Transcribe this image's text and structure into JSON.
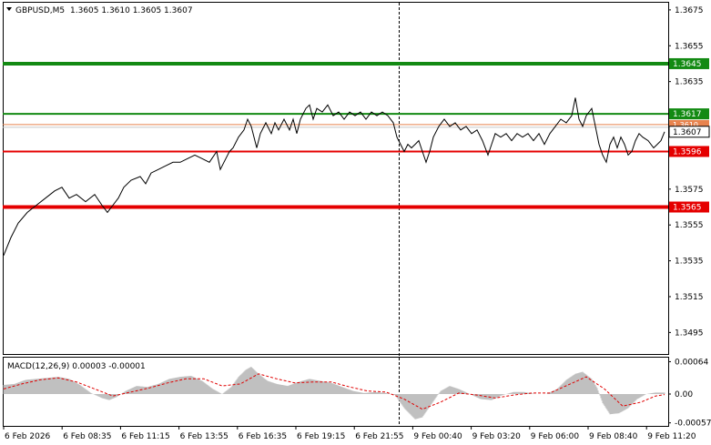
{
  "header": {
    "symbol": "GBPUSD,M5",
    "ohlc": "1.3605 1.3610 1.3605 1.3607",
    "dropdown_icon": "triangle-down-icon"
  },
  "macd": {
    "label": "MACD(12,26,9) 0.00003 -0.00001",
    "y_ticks": [
      "0.00064",
      "0.00",
      "-0.00057"
    ],
    "ylim": [
      -0.00063,
      0.00072
    ]
  },
  "price_axis": {
    "ticks": [
      "1.3675",
      "1.3655",
      "1.3635",
      "1.3575",
      "1.3555",
      "1.3535",
      "1.3515",
      "1.3495"
    ],
    "ylim": [
      1.3483,
      1.3679
    ]
  },
  "levels": [
    {
      "id": "resistance-1",
      "value": 1.3645,
      "label": "1.3645",
      "color": "#138a13",
      "width": 4
    },
    {
      "id": "resistance-2",
      "value": 1.3617,
      "label": "1.3617",
      "color": "#138a13",
      "width": 2
    },
    {
      "id": "support-1",
      "value": 1.3596,
      "label": "1.3596",
      "color": "#e50000",
      "width": 2
    },
    {
      "id": "support-2",
      "value": 1.3565,
      "label": "1.3565",
      "color": "#e50000",
      "width": 4
    }
  ],
  "current_price": {
    "value": 1.3607,
    "label": "1.3607"
  },
  "ask_line": {
    "value": 1.3611,
    "label": "1.3610",
    "color": "#e8834e"
  },
  "time_axis": [
    "6 Feb 2026",
    "6 Feb 08:35",
    "6 Feb 11:15",
    "6 Feb 13:55",
    "6 Feb 16:35",
    "6 Feb 19:15",
    "6 Feb 21:55",
    "9 Feb 00:40",
    "9 Feb 03:20",
    "9 Feb 06:00",
    "9 Feb 08:40",
    "9 Feb 11:20"
  ],
  "colors": {
    "price_line": "#000000",
    "histogram": "#c0c0c0",
    "signal": "#e00000",
    "grid": "#000000"
  },
  "chart_data": {
    "type": "line",
    "title": "GBPUSD,M5",
    "x": [
      "6 Feb 2026",
      "6 Feb 08:35",
      "6 Feb 11:15",
      "6 Feb 13:55",
      "6 Feb 16:35",
      "6 Feb 19:15",
      "6 Feb 21:55",
      "9 Feb 00:40",
      "9 Feb 03:20",
      "9 Feb 06:00",
      "9 Feb 08:40",
      "9 Feb 11:20"
    ],
    "series": [
      {
        "values": [
          1.3538,
          1.3572,
          1.357,
          1.3584,
          1.3604,
          1.3618,
          1.3616,
          1.3606,
          1.3605,
          1.3608,
          1.36,
          1.3607
        ]
      }
    ],
    "price_path": [
      [
        0,
        1.3538
      ],
      [
        8,
        1.3548
      ],
      [
        16,
        1.3556
      ],
      [
        26,
        1.3562
      ],
      [
        36,
        1.3566
      ],
      [
        46,
        1.357
      ],
      [
        56,
        1.3574
      ],
      [
        64,
        1.3576
      ],
      [
        72,
        1.357
      ],
      [
        80,
        1.3572
      ],
      [
        90,
        1.3568
      ],
      [
        100,
        1.3572
      ],
      [
        108,
        1.3566
      ],
      [
        114,
        1.3562
      ],
      [
        120,
        1.3566
      ],
      [
        126,
        1.357
      ],
      [
        132,
        1.3576
      ],
      [
        140,
        1.358
      ],
      [
        150,
        1.3582
      ],
      [
        156,
        1.3578
      ],
      [
        162,
        1.3584
      ],
      [
        170,
        1.3586
      ],
      [
        178,
        1.3588
      ],
      [
        186,
        1.359
      ],
      [
        194,
        1.359
      ],
      [
        202,
        1.3592
      ],
      [
        210,
        1.3594
      ],
      [
        218,
        1.3592
      ],
      [
        226,
        1.359
      ],
      [
        234,
        1.3596
      ],
      [
        238,
        1.3586
      ],
      [
        242,
        1.359
      ],
      [
        248,
        1.3596
      ],
      [
        252,
        1.3598
      ],
      [
        258,
        1.3604
      ],
      [
        264,
        1.3608
      ],
      [
        268,
        1.3614
      ],
      [
        272,
        1.361
      ],
      [
        278,
        1.3598
      ],
      [
        282,
        1.3606
      ],
      [
        288,
        1.3612
      ],
      [
        294,
        1.3606
      ],
      [
        298,
        1.3612
      ],
      [
        302,
        1.3608
      ],
      [
        308,
        1.3614
      ],
      [
        314,
        1.3608
      ],
      [
        318,
        1.3614
      ],
      [
        322,
        1.3606
      ],
      [
        326,
        1.3614
      ],
      [
        332,
        1.362
      ],
      [
        336,
        1.3622
      ],
      [
        340,
        1.3614
      ],
      [
        344,
        1.362
      ],
      [
        350,
        1.3618
      ],
      [
        356,
        1.3622
      ],
      [
        362,
        1.3616
      ],
      [
        368,
        1.3618
      ],
      [
        374,
        1.3614
      ],
      [
        380,
        1.3618
      ],
      [
        386,
        1.3616
      ],
      [
        392,
        1.3618
      ],
      [
        398,
        1.3614
      ],
      [
        404,
        1.3618
      ],
      [
        410,
        1.3616
      ],
      [
        416,
        1.3618
      ],
      [
        422,
        1.3616
      ],
      [
        428,
        1.3612
      ],
      [
        432,
        1.3604
      ],
      [
        436,
        1.36
      ],
      [
        440,
        1.3596
      ],
      [
        444,
        1.36
      ],
      [
        448,
        1.3598
      ],
      [
        452,
        1.36
      ],
      [
        456,
        1.3602
      ],
      [
        460,
        1.3596
      ],
      [
        464,
        1.359
      ],
      [
        468,
        1.3596
      ],
      [
        472,
        1.3604
      ],
      [
        478,
        1.361
      ],
      [
        484,
        1.3614
      ],
      [
        490,
        1.361
      ],
      [
        496,
        1.3612
      ],
      [
        502,
        1.3608
      ],
      [
        508,
        1.361
      ],
      [
        514,
        1.3606
      ],
      [
        520,
        1.3608
      ],
      [
        526,
        1.3602
      ],
      [
        532,
        1.3594
      ],
      [
        536,
        1.36
      ],
      [
        540,
        1.3606
      ],
      [
        546,
        1.3604
      ],
      [
        552,
        1.3606
      ],
      [
        558,
        1.3602
      ],
      [
        564,
        1.3606
      ],
      [
        570,
        1.3604
      ],
      [
        576,
        1.3606
      ],
      [
        582,
        1.3602
      ],
      [
        588,
        1.3606
      ],
      [
        594,
        1.36
      ],
      [
        600,
        1.3606
      ],
      [
        606,
        1.361
      ],
      [
        612,
        1.3614
      ],
      [
        618,
        1.3612
      ],
      [
        624,
        1.3616
      ],
      [
        628,
        1.3626
      ],
      [
        632,
        1.3614
      ],
      [
        636,
        1.361
      ],
      [
        640,
        1.3616
      ],
      [
        646,
        1.362
      ],
      [
        650,
        1.361
      ],
      [
        654,
        1.36
      ],
      [
        658,
        1.3594
      ],
      [
        662,
        1.359
      ],
      [
        666,
        1.36
      ],
      [
        670,
        1.3604
      ],
      [
        674,
        1.3598
      ],
      [
        678,
        1.3604
      ],
      [
        682,
        1.36
      ],
      [
        686,
        1.3594
      ],
      [
        690,
        1.3596
      ],
      [
        694,
        1.3602
      ],
      [
        698,
        1.3606
      ],
      [
        702,
        1.3604
      ],
      [
        708,
        1.3602
      ],
      [
        714,
        1.3598
      ],
      [
        718,
        1.36
      ],
      [
        722,
        1.3602
      ],
      [
        726,
        1.3607
      ]
    ],
    "macd_histogram": [
      [
        0,
        0.00018
      ],
      [
        12,
        0.0002
      ],
      [
        24,
        0.00028
      ],
      [
        36,
        0.0003
      ],
      [
        48,
        0.00032
      ],
      [
        60,
        0.00034
      ],
      [
        72,
        0.0003
      ],
      [
        84,
        0.00018
      ],
      [
        96,
        2e-05
      ],
      [
        108,
        -8e-05
      ],
      [
        116,
        -0.00012
      ],
      [
        124,
        -6e-05
      ],
      [
        134,
        6e-05
      ],
      [
        146,
        0.00016
      ],
      [
        158,
        0.00014
      ],
      [
        170,
        0.0002
      ],
      [
        182,
        0.0003
      ],
      [
        194,
        0.00034
      ],
      [
        206,
        0.00036
      ],
      [
        218,
        0.00026
      ],
      [
        230,
        0.0001
      ],
      [
        240,
        0.0
      ],
      [
        250,
        0.00014
      ],
      [
        258,
        0.00034
      ],
      [
        266,
        0.00048
      ],
      [
        272,
        0.00054
      ],
      [
        280,
        0.0004
      ],
      [
        290,
        0.00026
      ],
      [
        300,
        0.0002
      ],
      [
        312,
        0.00016
      ],
      [
        324,
        0.00024
      ],
      [
        336,
        0.0003
      ],
      [
        348,
        0.00026
      ],
      [
        360,
        0.00022
      ],
      [
        372,
        0.00014
      ],
      [
        384,
        6e-05
      ],
      [
        396,
        2e-05
      ],
      [
        408,
        4e-05
      ],
      [
        420,
        2e-05
      ],
      [
        430,
        -2e-05
      ],
      [
        440,
        -0.00028
      ],
      [
        452,
        -0.0005
      ],
      [
        460,
        -0.00046
      ],
      [
        470,
        -0.0002
      ],
      [
        480,
        6e-05
      ],
      [
        490,
        0.00016
      ],
      [
        500,
        0.0001
      ],
      [
        512,
        0.0
      ],
      [
        524,
        -0.0001
      ],
      [
        536,
        -0.00012
      ],
      [
        548,
        -2e-05
      ],
      [
        560,
        4e-05
      ],
      [
        572,
        4e-05
      ],
      [
        584,
        0.0
      ],
      [
        596,
        0.0
      ],
      [
        608,
        0.0001
      ],
      [
        618,
        0.00028
      ],
      [
        628,
        0.0004
      ],
      [
        636,
        0.00044
      ],
      [
        646,
        0.0003
      ],
      [
        652,
        0.00012
      ],
      [
        658,
        -0.00018
      ],
      [
        666,
        -0.0004
      ],
      [
        676,
        -0.00038
      ],
      [
        686,
        -0.00028
      ],
      [
        696,
        -0.0001
      ],
      [
        706,
        0.0
      ],
      [
        716,
        3e-05
      ],
      [
        726,
        3e-05
      ]
    ],
    "macd_signal": [
      [
        0,
        0.0001
      ],
      [
        20,
        0.0002
      ],
      [
        40,
        0.00028
      ],
      [
        60,
        0.00032
      ],
      [
        80,
        0.00024
      ],
      [
        100,
        0.0001
      ],
      [
        120,
        -4e-05
      ],
      [
        140,
        4e-05
      ],
      [
        160,
        0.00012
      ],
      [
        180,
        0.00022
      ],
      [
        200,
        0.0003
      ],
      [
        220,
        0.0003
      ],
      [
        240,
        0.00016
      ],
      [
        260,
        0.0002
      ],
      [
        280,
        0.0004
      ],
      [
        300,
        0.0003
      ],
      [
        320,
        0.00022
      ],
      [
        340,
        0.00024
      ],
      [
        360,
        0.00024
      ],
      [
        380,
        0.00014
      ],
      [
        400,
        6e-05
      ],
      [
        420,
        4e-05
      ],
      [
        440,
        -0.0001
      ],
      [
        460,
        -0.0003
      ],
      [
        480,
        -0.00016
      ],
      [
        500,
        2e-05
      ],
      [
        520,
        -2e-05
      ],
      [
        540,
        -8e-05
      ],
      [
        560,
        -2e-05
      ],
      [
        580,
        2e-05
      ],
      [
        600,
        2e-05
      ],
      [
        620,
        0.00018
      ],
      [
        640,
        0.00034
      ],
      [
        660,
        0.0001
      ],
      [
        680,
        -0.00024
      ],
      [
        700,
        -0.00016
      ],
      [
        716,
        -4e-05
      ],
      [
        726,
        -1e-05
      ]
    ],
    "ylim": [
      1.3483,
      1.3679
    ]
  }
}
